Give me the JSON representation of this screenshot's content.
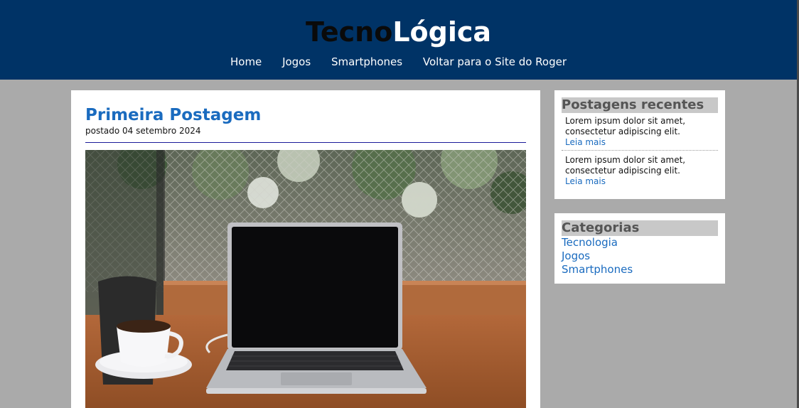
{
  "header": {
    "logo_part1": "Tecno",
    "logo_part2": "Lógica",
    "nav": [
      "Home",
      "Jogos",
      "Smartphones",
      "Voltar para o Site do Roger"
    ]
  },
  "post": {
    "title": "Primeira Postagem",
    "date": "postado 04 setembro 2024",
    "image_alt": "laptop and coffee cup on wooden table"
  },
  "sidebar": {
    "recent_heading": "Postagens recentes",
    "recent": [
      {
        "text": "Lorem ipsum dolor sit amet, consectetur adipiscing elit.",
        "link": "Leia mais"
      },
      {
        "text": "Lorem ipsum dolor sit amet, consectetur adipiscing elit.",
        "link": "Leia mais"
      }
    ],
    "categories_heading": "Categorias",
    "categories": [
      "Tecnologia",
      "Jogos",
      "Smartphones"
    ]
  },
  "colors": {
    "header_bg": "#003366",
    "page_bg": "#aaaaaa",
    "link": "#1a6bbf",
    "heading_bg": "#c8c8c8"
  }
}
